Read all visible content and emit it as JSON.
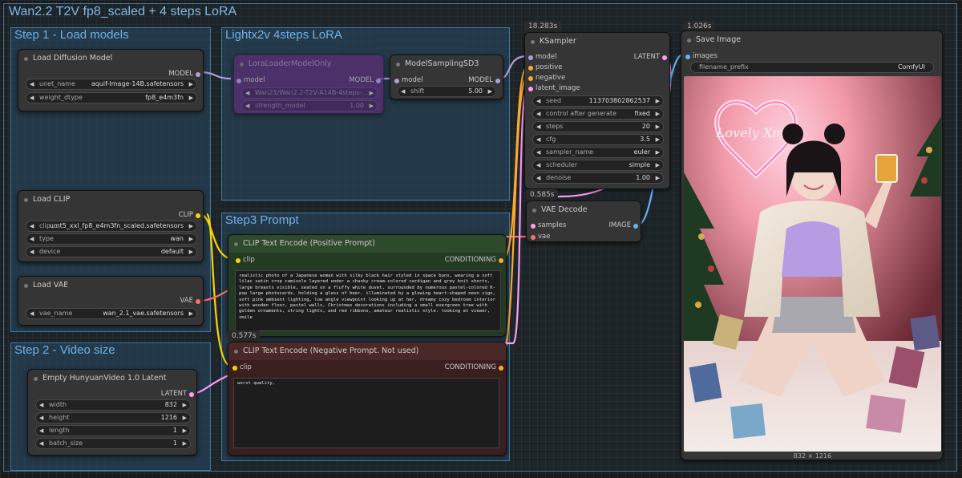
{
  "workflow_title": "Wan2.2 T2V fp8_scaled +  4 steps LoRA",
  "groups": {
    "step1": "Step 1 - Load models",
    "lora": "Lightx2v 4steps LoRA",
    "step2": "Step 2 - Video size",
    "step3": "Step3 Prompt"
  },
  "load_diffusion_model": {
    "title": "Load Diffusion Model",
    "output": "MODEL",
    "unet_name_label": "unet_name",
    "unet_name_value": "aquif-Image-14B.safetensors",
    "weight_dtype_label": "weight_dtype",
    "weight_dtype_value": "fp8_e4m3fn"
  },
  "lora_loader": {
    "title": "LoraLoaderModelOnly",
    "input": "model",
    "output": "MODEL",
    "lora_name_value": "Wan21/Wan2.2-T2V-A14B-4steps-...",
    "strength_label": "strength_model",
    "strength_value": "1.00"
  },
  "model_sampling": {
    "title": "ModelSamplingSD3",
    "input": "model",
    "output": "MODEL",
    "shift_label": "shift",
    "shift_value": "5.00"
  },
  "load_clip": {
    "title": "Load CLIP",
    "output": "CLIP",
    "clip_label": "clip ...",
    "clip_value": "umt5_xxl_fp8_e4m3fn_scaled.safetensors",
    "type_label": "type",
    "type_value": "wan",
    "device_label": "device",
    "device_value": "default"
  },
  "load_vae": {
    "title": "Load VAE",
    "output": "VAE",
    "vae_name_label": "vae_name",
    "vae_name_value": "wan_2.1_vae.safetensors"
  },
  "empty_latent": {
    "title": "Empty HunyuanVideo 1.0 Latent",
    "output": "LATENT",
    "width_label": "width",
    "width_value": "832",
    "height_label": "height",
    "height_value": "1216",
    "length_label": "length",
    "length_value": "1",
    "batch_label": "batch_size",
    "batch_value": "1"
  },
  "clip_pos": {
    "title": "CLIP Text Encode (Positive Prompt)",
    "input": "clip",
    "output": "CONDITIONING",
    "text": "realistic photo of a Japanese woman with silky black hair styled in space buns, wearing a soft lilac satin crop camisole layered under a chunky cream-colored cardigan and grey knit shorts, large breasts visible, seated on a fluffy white duvet, surrounded by numerous pastel-colored K- pop large photocards, holding a glass of beer, illuminated by a glowing heart-shaped neon sign, soft pink ambient lighting, low angle viewpoint looking up at her, dreamy cozy bedroom interior with wooden floor, pastel walls, Christmas decorations including a small evergreen tree with golden ornaments, string lights, and red ribbons, amateur realistic style. looking at viewer, smile"
  },
  "clip_neg": {
    "title": "CLIP Text Encode (Negative Prompt. Not used)",
    "badge": "0.577s",
    "input": "clip",
    "output": "CONDITIONING",
    "text": "worst quality,"
  },
  "ksampler": {
    "title": "KSampler",
    "badge": "18.283s",
    "inputs": [
      "model",
      "positive",
      "negative",
      "latent_image"
    ],
    "output": "LATENT",
    "seed_label": "seed",
    "seed_value": "113703802862537",
    "control_label": "control after generate",
    "control_value": "fixed",
    "steps_label": "steps",
    "steps_value": "20",
    "cfg_label": "cfg",
    "cfg_value": "3.5",
    "sampler_label": "sampler_name",
    "sampler_value": "euler",
    "scheduler_label": "scheduler",
    "scheduler_value": "simple",
    "denoise_label": "denoise",
    "denoise_value": "1.00"
  },
  "vae_decode": {
    "title": "VAE Decode",
    "badge": "0.585s",
    "input_samples": "samples",
    "input_vae": "vae",
    "output": "IMAGE"
  },
  "save_image": {
    "title": "Save Image",
    "badge": "1.026s",
    "input": "images",
    "prefix_label": "filename_prefix",
    "prefix_value": "ComfyUI",
    "neon_text": "Lovely Xmas",
    "size_caption": "832 × 1216"
  },
  "colors": {
    "model": "#b39ddb",
    "clip": "#ffd500",
    "vae": "#ff6e6e",
    "conditioning": "#ffa931",
    "latent": "#ff9cf9",
    "image": "#64b5f6"
  }
}
